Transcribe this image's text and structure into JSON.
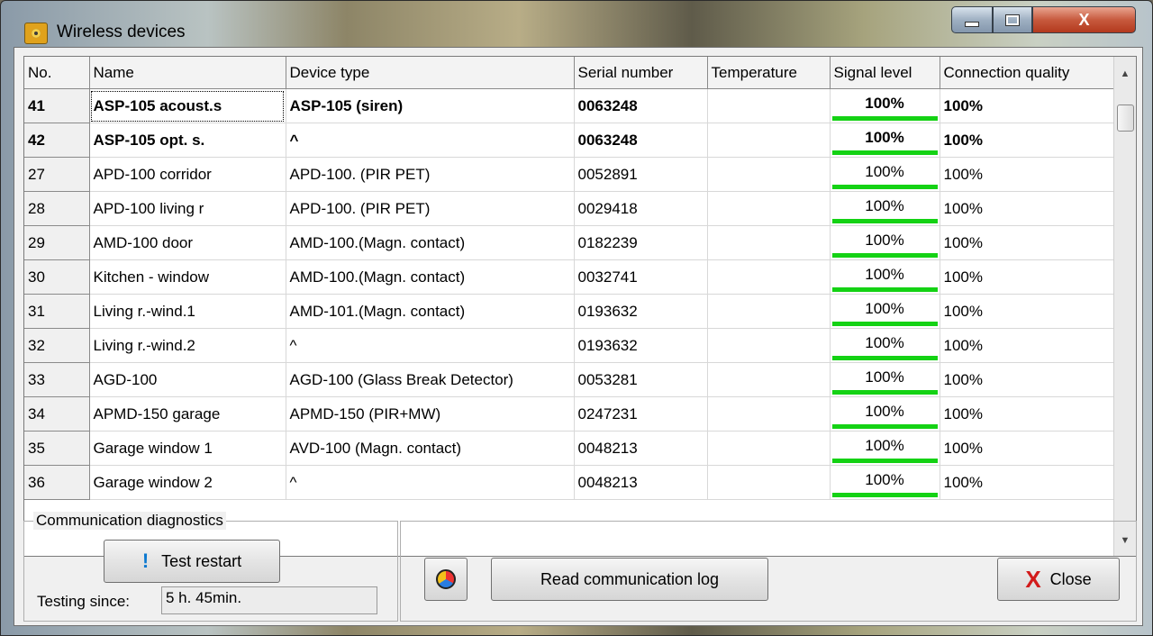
{
  "window": {
    "title": "Wireless devices"
  },
  "titlebar_buttons": {
    "minimize": "minimize",
    "maximize": "maximize",
    "close": "X"
  },
  "grid": {
    "columns": [
      "No.",
      "Name",
      "Device type",
      "Serial number",
      "Temperature",
      "Signal level",
      "Connection quality"
    ],
    "rows": [
      {
        "no": "41",
        "name": "ASP-105 acoust.s",
        "type": "ASP-105 (siren)",
        "serial": "0063248",
        "temperature": "",
        "signal": "100%",
        "quality": "100%",
        "bold": true
      },
      {
        "no": "42",
        "name": "ASP-105 opt. s.",
        "type": "^",
        "serial": "0063248",
        "temperature": "",
        "signal": "100%",
        "quality": "100%",
        "bold": true
      },
      {
        "no": "27",
        "name": "APD-100 corridor",
        "type": "APD-100. (PIR PET)",
        "serial": "0052891",
        "temperature": "",
        "signal": "100%",
        "quality": "100%",
        "bold": false
      },
      {
        "no": "28",
        "name": "APD-100 living r",
        "type": "APD-100. (PIR PET)",
        "serial": "0029418",
        "temperature": "",
        "signal": "100%",
        "quality": "100%",
        "bold": false
      },
      {
        "no": "29",
        "name": "AMD-100 door",
        "type": "AMD-100.(Magn. contact)",
        "serial": "0182239",
        "temperature": "",
        "signal": "100%",
        "quality": "100%",
        "bold": false
      },
      {
        "no": "30",
        "name": "Kitchen - window",
        "type": "AMD-100.(Magn. contact)",
        "serial": "0032741",
        "temperature": "",
        "signal": "100%",
        "quality": "100%",
        "bold": false
      },
      {
        "no": "31",
        "name": "Living r.-wind.1",
        "type": "AMD-101.(Magn. contact)",
        "serial": "0193632",
        "temperature": "",
        "signal": "100%",
        "quality": "100%",
        "bold": false
      },
      {
        "no": "32",
        "name": "Living r.-wind.2",
        "type": "^",
        "serial": "0193632",
        "temperature": "",
        "signal": "100%",
        "quality": "100%",
        "bold": false
      },
      {
        "no": "33",
        "name": "AGD-100",
        "type": "AGD-100 (Glass Break Detector)",
        "serial": "0053281",
        "temperature": "",
        "signal": "100%",
        "quality": "100%",
        "bold": false
      },
      {
        "no": "34",
        "name": "APMD-150 garage",
        "type": "APMD-150 (PIR+MW)",
        "serial": "0247231",
        "temperature": "",
        "signal": "100%",
        "quality": "100%",
        "bold": false
      },
      {
        "no": "35",
        "name": "Garage window 1",
        "type": "AVD-100 (Magn. contact)",
        "serial": "0048213",
        "temperature": "",
        "signal": "100%",
        "quality": "100%",
        "bold": false
      },
      {
        "no": "36",
        "name": "Garage window 2",
        "type": "^",
        "serial": "0048213",
        "temperature": "",
        "signal": "100%",
        "quality": "100%",
        "bold": false
      }
    ],
    "signal_bar_color": "#14d214"
  },
  "diagnostics": {
    "legend": "Communication diagnostics",
    "test_restart_label": "Test restart",
    "test_icon": "!",
    "testing_since_label": "Testing since:",
    "testing_since_value": "5 h. 45min."
  },
  "log": {
    "read_log_label": "Read communication log",
    "log_icon": "log-icon"
  },
  "close": {
    "label": "Close",
    "icon": "X"
  }
}
